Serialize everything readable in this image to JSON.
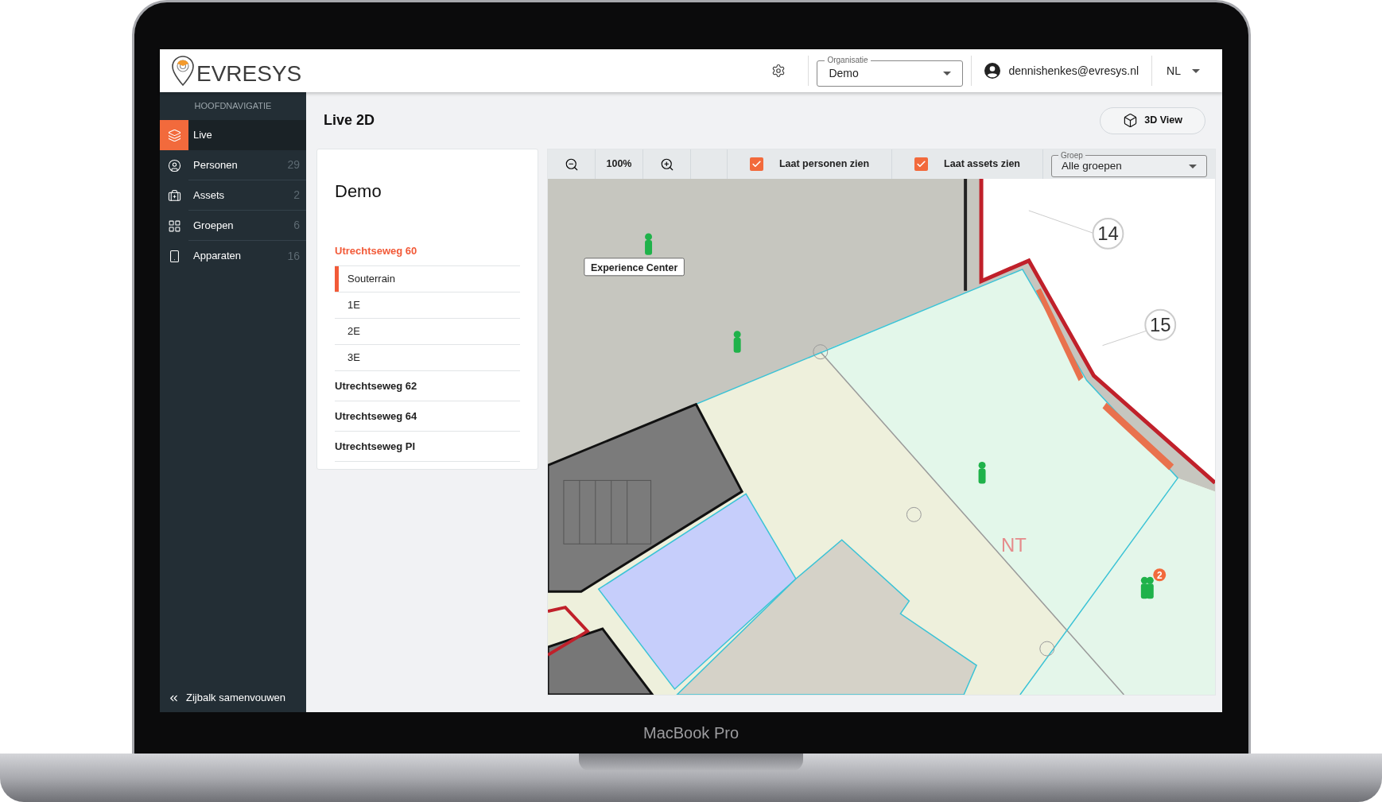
{
  "header": {
    "logo": "EVRESYS",
    "organisation": {
      "label": "Organisatie",
      "value": "Demo"
    },
    "user": "dennishenkes@evresys.nl",
    "language": "NL"
  },
  "sidebar": {
    "heading": "HOOFDNAVIGATIE",
    "items": [
      {
        "label": "Live",
        "selected": true
      },
      {
        "label": "Personen",
        "count": "29",
        "selected": false
      },
      {
        "label": "Assets",
        "count": "2",
        "selected": false
      },
      {
        "label": "Groepen",
        "count": "6",
        "selected": false
      },
      {
        "label": "Apparaten",
        "count": "16",
        "selected": false
      }
    ],
    "collapse": "Zijbalk samenvouwen"
  },
  "page": {
    "title": "Live 2D",
    "view_button": "3D View"
  },
  "locations": {
    "title": "Demo",
    "buildings": [
      {
        "name": "Utrechtseweg 60",
        "selected": true,
        "floors": [
          {
            "name": "Souterrain",
            "selected": true
          },
          {
            "name": "1E",
            "selected": false
          },
          {
            "name": "2E",
            "selected": false
          },
          {
            "name": "3E",
            "selected": false
          }
        ]
      },
      {
        "name": "Utrechtseweg 62",
        "selected": false
      },
      {
        "name": "Utrechtseweg 64",
        "selected": false
      },
      {
        "name": "Utrechtseweg PI",
        "selected": false
      }
    ]
  },
  "toolbar": {
    "zoom": "100%",
    "show_persons": {
      "label": "Laat personen zien",
      "checked": true
    },
    "show_assets": {
      "label": "Laat assets zien",
      "checked": true
    },
    "group": {
      "label": "Groep",
      "value": "Alle groepen"
    }
  },
  "map": {
    "room_label": "Experience Center",
    "axis_markers": [
      "14",
      "15"
    ],
    "zone_label": "NT",
    "cluster_count": "2"
  },
  "device": {
    "model": "MacBook Pro"
  }
}
